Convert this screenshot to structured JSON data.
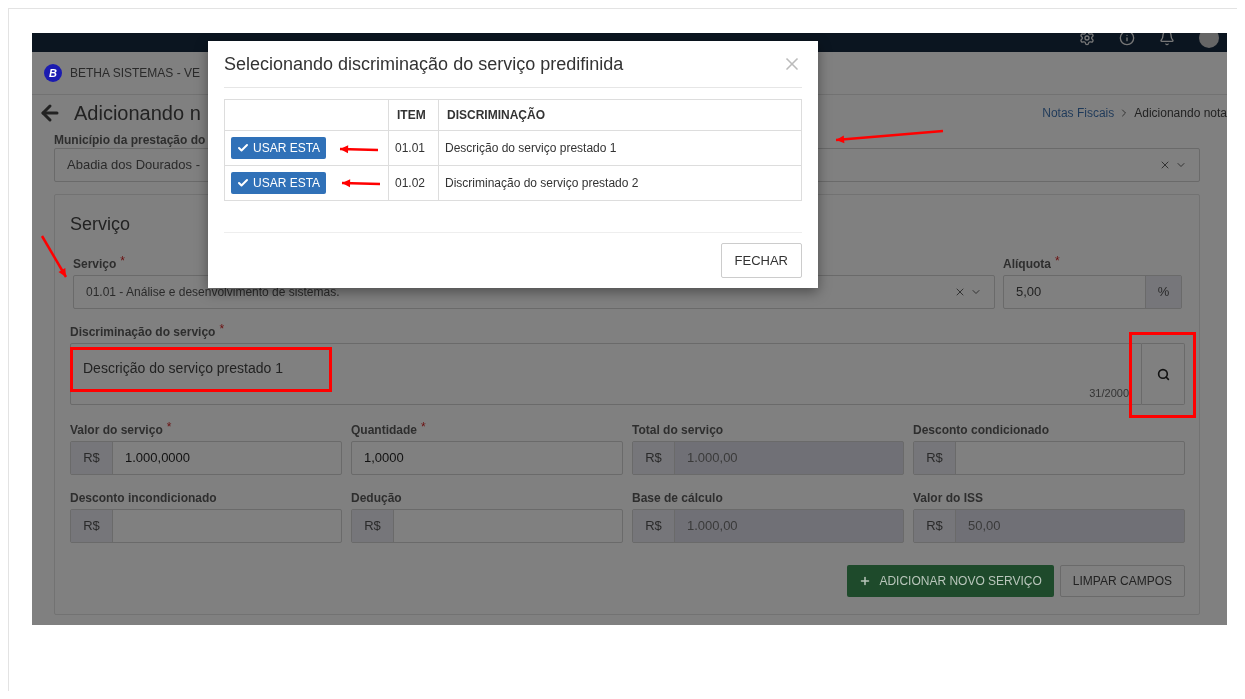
{
  "app_header": {
    "brand_initial": "B",
    "brand": "BETHA SISTEMAS - VE"
  },
  "page": {
    "title": "Adicionando n",
    "breadcrumb": [
      {
        "label": "Notas Fiscais",
        "kind": "link"
      },
      {
        "label": "Adicionando nota",
        "kind": "current"
      }
    ]
  },
  "municipio": {
    "label": "Município da prestação do",
    "value": "Abadia dos Dourados -"
  },
  "servico_panel": {
    "title": "Serviço",
    "servico": {
      "label": "Serviço",
      "mark": "*",
      "value": "01.01 - Análise e desenvolvimento de sistemas."
    },
    "aliquota": {
      "label": "Alíquota",
      "mark": "*",
      "value": "5,00",
      "suffix": "%"
    },
    "discriminacao": {
      "label": "Discriminação do serviço",
      "mark": "*",
      "value": "Descrição do serviço prestado 1",
      "counter": "31/2000"
    },
    "fields": [
      {
        "label": "Valor do serviço",
        "mark": "*",
        "prefix": "R$",
        "value": "1.000,0000",
        "disabled": false
      },
      {
        "label": "Quantidade",
        "mark": "*",
        "value": "1,0000",
        "disabled": false
      },
      {
        "label": "Total do serviço",
        "prefix": "R$",
        "value": "1.000,00",
        "disabled": true
      },
      {
        "label": "Desconto condicionado",
        "prefix": "R$",
        "disabled": false
      },
      {
        "label": "Desconto incondicionado",
        "prefix": "R$",
        "disabled": false
      },
      {
        "label": "Dedução",
        "prefix": "R$",
        "disabled": false
      },
      {
        "label": "Base de cálculo",
        "prefix": "R$",
        "value": "1.000,00",
        "disabled": true
      },
      {
        "label": "Valor do ISS",
        "prefix": "R$",
        "value": "50,00",
        "disabled": true
      }
    ],
    "buttons": [
      {
        "label": "ADICIONAR NOVO SERVIÇO",
        "kind": "primary"
      },
      {
        "label": "LIMPAR CAMPOS",
        "kind": "default"
      }
    ]
  },
  "modal": {
    "title": "Selecionando discriminação do serviço predifinida",
    "columns": [
      "ITEM",
      "DISCRIMINAÇÃO"
    ],
    "rows": [
      {
        "action": "USAR ESTA",
        "item": "01.01",
        "discriminacao": "Descrição do serviço prestado 1"
      },
      {
        "action": "USAR ESTA",
        "item": "01.02",
        "discriminacao": "Discriminação do serviço prestado 2"
      }
    ],
    "close_button": "FECHAR"
  }
}
